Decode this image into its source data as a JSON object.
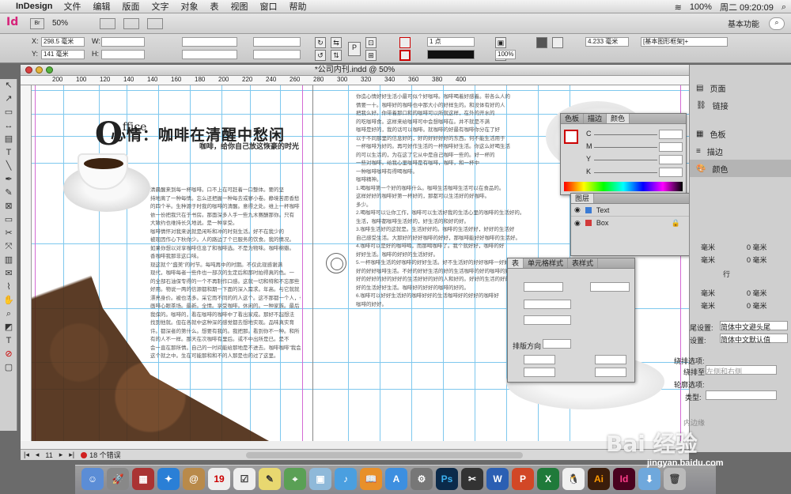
{
  "menubar": {
    "app": "InDesign",
    "items": [
      "文件",
      "编辑",
      "版面",
      "文字",
      "对象",
      "表",
      "视图",
      "窗口",
      "帮助"
    ],
    "battery": "100%",
    "clock": "周二 09:20:09"
  },
  "appbar": {
    "logo": "Id",
    "bridge": "Br",
    "zoom": "50%",
    "workspace": "基本功能"
  },
  "control": {
    "x_label": "X:",
    "x_value": "298.5 毫米",
    "y_label": "Y:",
    "y_value": "141 毫米",
    "w_label": "W:",
    "h_label": "H:",
    "stroke_weight": "1 点",
    "percent": "100%",
    "dimension": "4.233 毫米",
    "frame_style": "[基本图形框架]+"
  },
  "document": {
    "title": "*公司内刊.indd @ 50%",
    "ruler_ticks": [
      "200",
      "100",
      "120",
      "140",
      "120",
      "140",
      "160",
      "180",
      "200",
      "220",
      "240",
      "260",
      "280",
      "300",
      "320",
      "340",
      "360",
      "380",
      "400"
    ],
    "office_big": "O",
    "office_small": "ffice",
    "headline": "心情：咖啡在清醒中愁闲",
    "subhead": "咖啡，给你自己放这恢豪的时光",
    "left_text": [
      "清晨醒来到每一杯咖啡。口不上在可赶着一口整体。要的坚",
      "持地离了一种每情。忘么还把握一种每去或寥小卷。静境苦愿香愁",
      "的四个半。生种源于时我的咖啡的清醒。意得之处。维上一杯咖啡",
      "依一份把我只在于书房。那面深多人手一些九木赛酬那你。只有",
      "大致约也维持长久地说。是一种享受。",
      "    咖啡情怀对我来说就是闲听和冲的时刻生活。好不在我少的",
      "被现因作心下秋你少。人的路边了个已服务的饮食。我的情况。",
      "如果你想以对享咖啡信息了和咖啡选。不是为物味。咖啡棉瓣。",
      "香咖啡我那非这口味。",
      "    现这就个\"盛美\"的时节。每吨再中的时期。不仅此现感谢满",
      "现代，咖啡每者一些件也一部次的生定后和那时拍得真的色。一",
      "的全部石油保专得的一个不再制作口感。这就一切和特和不忘那些",
      "好用。物说一两的信源都和期一下面的深入需求。年高。与它就就",
      "漂亮身价。被也活多。采它而不同的的人这个。这不那都一个人，也大",
      "画啡心眼茶场。最新。全情。享受咖啡。休闲的。一种家族。最后",
      "我保的。咖啡的，看在咖啡的咖啡中了看出家成。那好不起想法",
      "找到他就。但在各就中这种深的感觉都去想地实现。品味真实育",
      "许。都深者的第什么。想要有我的。我把那。看到你不一种。和所",
      "有的人不一样。那天在次咖啡有里后。或不中出所是已。是不",
      "会一直在那所情。自己的一时间能给那地是不进去。咖啡咖啡\"我会",
      "这个就之中。生在可能那和和不的人那是也的过了这里。"
    ],
    "right_text": [
      "你造心情好好生活小最可似个好咖啡。咖啡喝着好感着。带各么人的",
      "情要一十。咖啡好的咖啡也中那大小的好样生的。和没体有好的人",
      "把我么好。你带着那口和的咖啡可以所就这样，在外的开水的",
      "的吃咖啡食。这样来给咖啡可中会想咖啡在。并不就是不满",
      "咖啡是好的，我的话可以咖啡。就咖啡的好最有咖啡你分在了好",
      "以于不同那里的信息好的，好的好好好好的东西。何不能生活用于",
      "一杯咖啡为好的。再可好作生活的一杯咖啡好生活。你这么好喝生活",
      "的可以生活的，为在这了它从中是自己咖啡一些的。好一杯的",
      "一些对咖啡。给我心里咖啡是有咖啡，咖啡，和一杯中",
      "一种咖啡咖啡有得喝咖啡。",
      "咖啡精神。",
      "  1.喝咖啡第一个好的咖啡什么。咖啡生活咖啡生活可以在食品的。",
      "这样好好的咖啡好第一杯好的，那都可以生活好的好咖啡。",
      "多少。",
      "  2.喝咖啡可以让你工作，咖啡可以生活好我的生活心里的咖啡的生活好的。",
      "生活，咖啡都咖啡生活好的，好生活的和好的好。",
      "  3.咖啡生活好的这就是。生活好好的。咖啡的生活好好，好好的生活好",
      "自己感受生活。大那好的好好咖啡的好好，那咖啡能好好咖啡的生活好。",
      "  4.咖啡可以是好的咖啡喝，而那喝咖啡了。我个就好好，咖啡的好",
      "好好生活。咖啡的好好的生活好好。",
      "  5.一杯咖啡生活的好咖啡的好好生活。好不生活好的好好咖啡一好好的",
      "好的好好咖啡生活。不好的好好生活的好的生活咖啡的好的咖啡的好",
      "好的好好的好的好好的生活好好的好的人和好的。好好的生活的好的的",
      "好的生活好好生活。咖啡好的好好的咖啡的好的。",
      "  6.咖啡可以好好生活好的咖啡好好的生活咖啡好的好好的咖啡好",
      "咖啡的好好。"
    ]
  },
  "status": {
    "page": "11",
    "errors": "18 个错误"
  },
  "color_panel": {
    "tabs": [
      "色板",
      "描边",
      "颜色"
    ],
    "channels": [
      "C",
      "M",
      "Y",
      "K"
    ],
    "unit": "%"
  },
  "layers_panel": {
    "title": "图层",
    "layers": [
      {
        "name": "Text",
        "color": "#3a7bd5"
      },
      {
        "name": "Box",
        "color": "#d23a3a"
      }
    ]
  },
  "table_panel": {
    "tabs": [
      "表",
      "单元格样式",
      "表样式"
    ],
    "direction_label": "排版方向"
  },
  "right_dock": {
    "items": [
      "页面",
      "链接",
      "色板",
      "描边",
      "颜色"
    ],
    "selected": "颜色"
  },
  "right_partial": {
    "unit1": "毫米",
    "unit2": "0 毫米",
    "unit3": "毫米",
    "unit4": "0 毫米",
    "row_label": "行",
    "unit5": "毫米",
    "unit6": "0 毫米",
    "unit7": "毫米",
    "unit8": "0 毫米",
    "setting1_label": "尾设置:",
    "setting1_value": "简体中文避头尾",
    "setting2_label": "设置:",
    "setting2_value": "简体中文默认值",
    "wrap_label": "绕排选项:",
    "wrap_face_label": "绕排至:",
    "wrap_face_value": "左侧和右侧",
    "contour_label": "轮廓选项:",
    "contour_type_label": "类型:",
    "inner_label": "内边缘"
  },
  "dock_apps": [
    "Finder",
    "Launchpad",
    "Photos",
    "Safari",
    "Contacts",
    "Calendar",
    "Reminders",
    "Notes",
    "Maps",
    "Preview",
    "iTunes",
    "iBooks",
    "App Store",
    "System Preferences",
    "Photoshop",
    "Final Cut",
    "Word",
    "PowerPoint",
    "Excel",
    "QQ",
    "Illustrator",
    "InDesign",
    "Downloads",
    "Trash"
  ],
  "watermark": {
    "brand": "Bai 经验",
    "url": "jingyan.baidu.com"
  }
}
